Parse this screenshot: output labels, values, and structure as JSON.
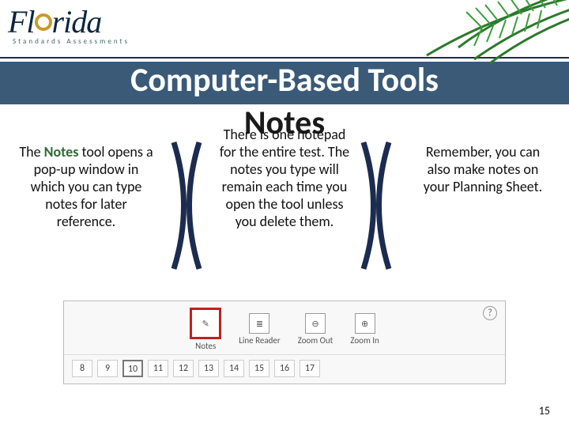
{
  "logo": {
    "main": "Florida",
    "sub": "Standards Assessments"
  },
  "title": "Computer-Based Tools",
  "subtitle": "Notes",
  "columns": {
    "left": {
      "pre": "The ",
      "strong": "Notes",
      "rest": " tool opens a pop-up window in which you can type notes for later reference."
    },
    "middle": "There is one notepad for the entire test. The notes you type will remain each time you open the tool unless you delete them.",
    "right": "Remember, you can also make notes on your Planning Sheet."
  },
  "toolbar": {
    "help": "?",
    "items": [
      {
        "label": "Notes",
        "glyph": "✎",
        "highlight": true
      },
      {
        "label": "Line Reader",
        "glyph": "≣",
        "highlight": false
      },
      {
        "label": "Zoom Out",
        "glyph": "⊖",
        "highlight": false
      },
      {
        "label": "Zoom In",
        "glyph": "⊕",
        "highlight": false
      }
    ],
    "numbers": [
      "8",
      "9",
      "10",
      "11",
      "12",
      "13",
      "14",
      "15",
      "16",
      "17"
    ],
    "current": "10"
  },
  "page": "15"
}
